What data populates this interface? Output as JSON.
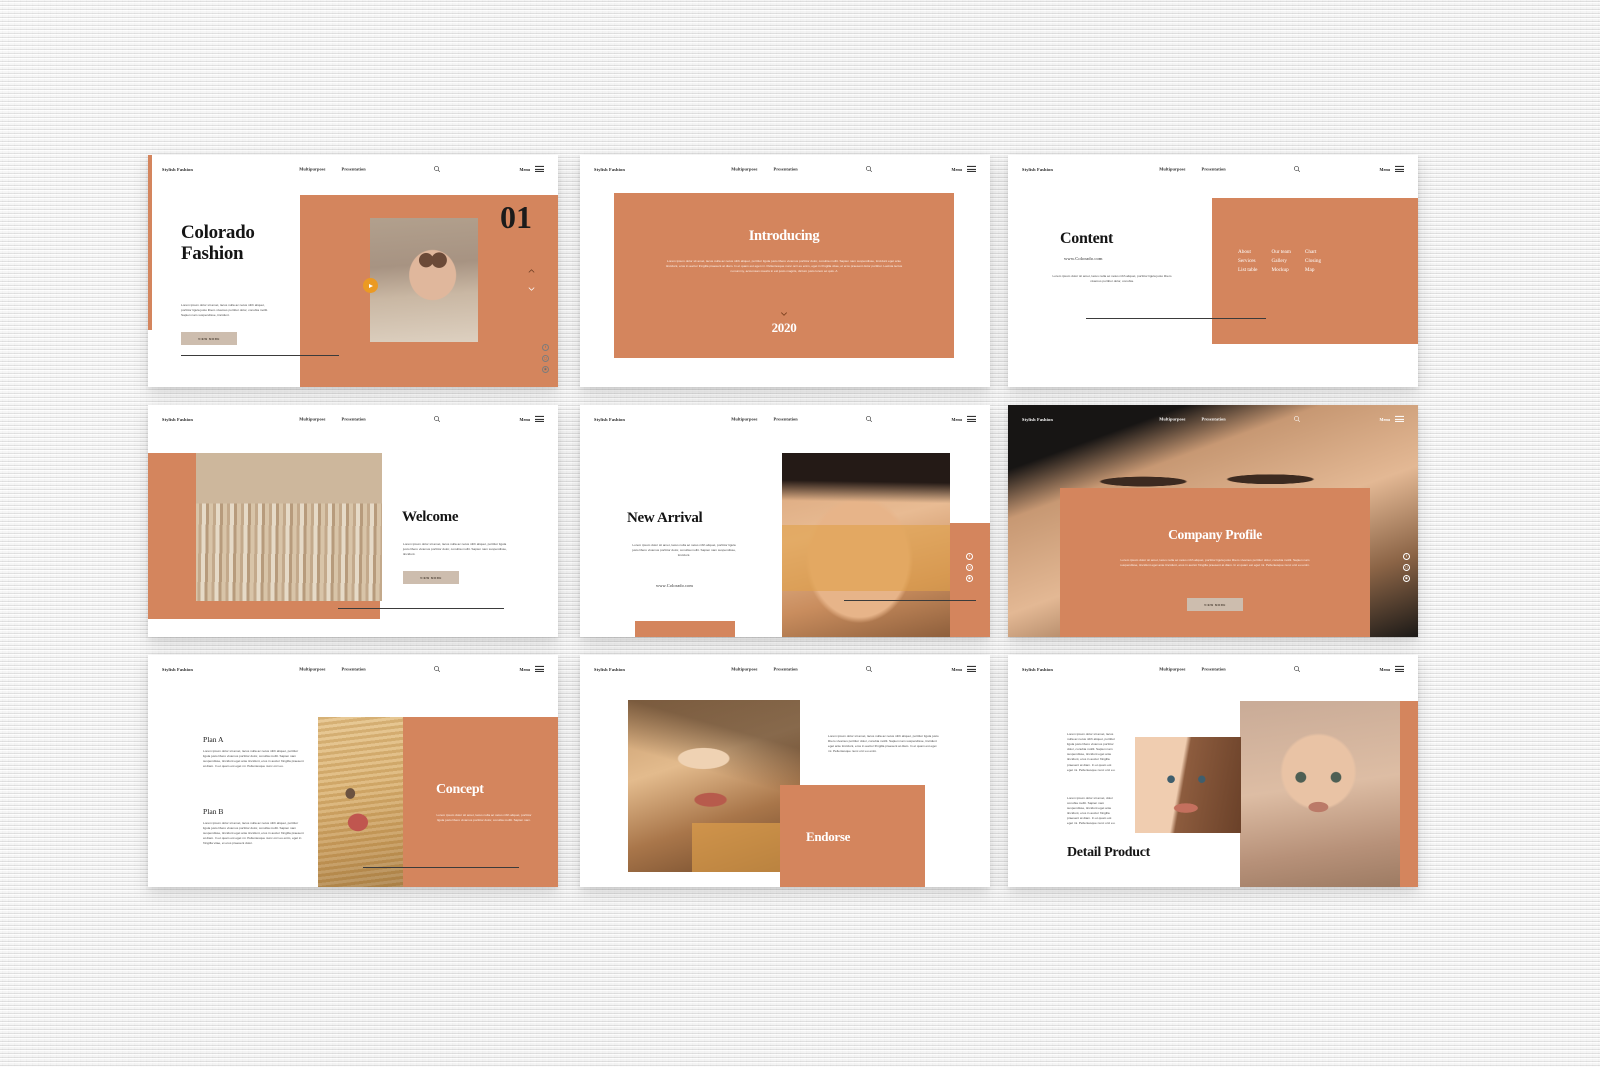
{
  "header": {
    "brand": "Stylish Fashion",
    "nav": [
      "Multipurpose",
      "Presentation"
    ],
    "search_icon": "search-icon",
    "menu_label": "Menu",
    "menu_icon": "hamburger-icon"
  },
  "common": {
    "view_more": "VIEW MORE",
    "website": "www.Colorado.com",
    "lorem_short": "Lorem ipsum dolor sit amet, lacus nulla ac netus nibh aliquet, porttitor ligula justo libero vivamus porttitor dolor, conubia mollit. Sapien nam suspendisse, tincidunt.",
    "lorem_medium": "Lorem ipsum dolor sit amet, lacus nulla ac netus nibh aliquet, porttitor ligula justo libero vivamus porttitor dolor, conubia mollit. Sapien nam suspendisse, tincidunt eget ante tincidunt, eros in auctor fringilla praesent at diam. In et quam est eget mi. Pellentesque nunc orci eu enim.",
    "lorem_tiny": "Lorem ipsum dolor sit amet, lacus nulla ac netus nibh aliquet, porttitor ligula justo libero vivamus porttitor dolor, conubia.",
    "social": [
      "twitter-icon",
      "instagram-icon",
      "pinterest-icon"
    ]
  },
  "colors": {
    "accent_orange": "#d4855d",
    "mustard": "#e0a14a",
    "button_tan": "#cdbdae",
    "play_amber": "#eb9a23",
    "dark": "#1b1b1b",
    "page_bg": "#eeeeee"
  },
  "slides": [
    {
      "id": "cover",
      "number": "01",
      "title_line1": "Colorado",
      "title_line2": "Fashion",
      "body": "Lorem ipsum dolor sit amet, lacus nulla ac netus nibh aliquet, porttitor ligula justo libero vivamus porttitor dolor, conubia mollit. Sapien nam suspendisse, tincidunt.",
      "button": "VIEW MORE",
      "photo": "woman-with-glasses",
      "up_icon": "chevron-up-icon",
      "down_icon": "chevron-down-icon",
      "play_icon": "play-icon"
    },
    {
      "id": "introducing",
      "title": "Introducing",
      "body": "Lorem ipsum dolor sit amet, lacus nulla ac netus nibh aliquet, porttitor ligula justo libero vivamus porttitor dolor, conubia mollit. Sapien nam suspendisse, tincidunt eget ante tincidunt, eros in auctor fringilla praesent at diam. In et quam est eget mi. Pellentesque nunc orci eu enim, eget in fringilla vitae, et eros praesent dolor porttitor. Lacinia lectus nonummy, accumsan mauris in est justo magnis, dictum justo lorem ac quis. A",
      "year": "2020",
      "down_icon": "chevron-down-icon"
    },
    {
      "id": "content",
      "title": "Content",
      "website": "www.Colorado.com",
      "body": "Lorem ipsum dolor sit amet, lacus nulla ac netus nibh aliquet, porttitor ligula justo libero vivamus porttitor dolor, conubia.",
      "toc": [
        "About",
        "Our team",
        "Chart",
        "Services",
        "Gallery",
        "Closing",
        "List table",
        "Mockup",
        "Map"
      ]
    },
    {
      "id": "welcome",
      "title": "Welcome",
      "body": "Lorem ipsum dolor sit amet, lacus nulla ac netus nibh aliquet, porttitor ligula justo libero vivamus porttitor dolor, conubia mollit. Sapien nam suspendisse, tincidunt.",
      "button": "VIEW MORE",
      "photo": "fashion-studio-workspace"
    },
    {
      "id": "new-arrival",
      "title": "New Arrival",
      "body": "Lorem ipsum dolor sit amet, lacus nulla ac netus nibh aliquet, porttitor ligula justo libero vivamus porttitor dolor, conubia mollit. Sapien nam suspendisse, tincidunt.",
      "website": "www.Colorado.com",
      "photo": "necklace-closeup"
    },
    {
      "id": "company-profile",
      "title": "Company Profile",
      "body": "Lorem ipsum dolor sit amet, lacus nulla ac netus nibh aliquet, porttitor ligula justo libero vivamus porttitor dolor, conubia mollit. Sapien nam suspendisse, tincidunt eget ante tincidunt, eros in auctor fringilla praesent at diam. In et quam est eget mi. Pellentesque nunc orci eu enim.",
      "button": "VIEW MORE",
      "photo": "blue-eyes-closeup"
    },
    {
      "id": "concept",
      "plan_a_title": "Plan A",
      "plan_a_body": "Lorem ipsum dolor sit amet, lacus nulla ac netus nibh aliquet, porttitor ligula justo libero vivamus porttitor dolor, conubia mollit. Sapien nam suspendisse, tincidunt eget ante tincidunt, eros in auctor fringilla praesent at diam. In et quam est eget mi. Pellentesque nunc orci eu.",
      "plan_b_title": "Plan B",
      "plan_b_body": "Lorem ipsum dolor sit amet, lacus nulla ac netus nibh aliquet, porttitor ligula justo libero vivamus porttitor dolor, conubia mollit. Sapien nam suspendisse, tincidunt eget ante tincidunt, eros in auctor fringilla praesent at diam. In et quam est eget mi. Pellentesque nunc orci eu enim, eget in fringilla vitae, et eros praesent dolor.",
      "title": "Concept",
      "body": "Lorem ipsum dolor sit amet, lacus nulla ac netus nibh aliquet, porttitor ligula justo libero vivamus porttitor dolor, conubia mollit. Sapien nam.",
      "photo": "blonde-model"
    },
    {
      "id": "endorse",
      "title": "Endorse",
      "body": "Lorem ipsum dolor sit amet, lacus nulla ac netus nibh aliquet, porttitor ligula justo libero vivamus porttitor dolor, conubia mollit. Sapien nam suspendisse, tincidunt eget ante tincidunt, eros in auctor fringilla praesent at diam. In et quam est eget mi. Pellentesque nunc orci eu enim.",
      "photo": "model-shading-eyes"
    },
    {
      "id": "detail-product",
      "title": "Detail Product",
      "body_1": "Lorem ipsum dolor sit amet, lacus nulla ac netus nibh aliquet, porttitor ligula justo libero vivamus porttitor dolor, conubia mollit. Sapien nam suspendisse, tincidunt eget ante tincidunt, eros in auctor fringilla praesent at diam. In et quam est eget mi. Pellentesque nunc orci eu.",
      "body_2": "Lorem ipsum dolor sit amet, dolor conubia mollit. Sapien nam suspendisse, tincidunt eget ante tincidunt, eros in auctor fringilla praesent at diam. In et quam est eget mi. Pellentesque nunc orci eu.",
      "photo_left": "face-half-shadow",
      "photo_right": "portrait-model"
    }
  ]
}
